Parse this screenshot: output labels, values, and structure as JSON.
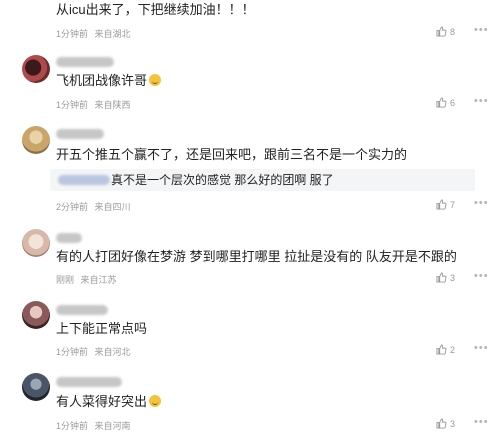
{
  "comments": [
    {
      "text": "从icu出来了，下把继续加油！！！",
      "time": "1分钟前",
      "location": "来自湖北",
      "likes": "8"
    },
    {
      "text": "飞机团战像许哥",
      "time": "1分钟前",
      "location": "来自陕西",
      "likes": "6",
      "avatar_color": "#b04a4a"
    },
    {
      "text": "开五个推五个赢不了，还是回来吧，跟前三名不是一个实力的",
      "reply_text": "真不是一个层次的感觉 那么好的团啊 服了",
      "time": "2分钟前",
      "location": "来自四川",
      "likes": "7",
      "avatar_color": "#c9a56a"
    },
    {
      "text": "有的人打团好像在梦游 梦到哪里打哪里 拉扯是没有的 队友开是不跟的",
      "time": "刚刚",
      "location": "来自江苏",
      "likes": "3",
      "avatar_color": "#d8b8a8"
    },
    {
      "text": "上下能正常点吗",
      "time": "1分钟前",
      "location": "来自河北",
      "likes": "2",
      "avatar_color": "#8a5a5a"
    },
    {
      "text": "有人菜得好突出",
      "time": "1分钟前",
      "location": "来自河南",
      "likes": "3",
      "avatar_color": "#4a5568"
    }
  ],
  "icons": {
    "like": "thumbs-up-icon",
    "more": "more-dots-icon"
  }
}
